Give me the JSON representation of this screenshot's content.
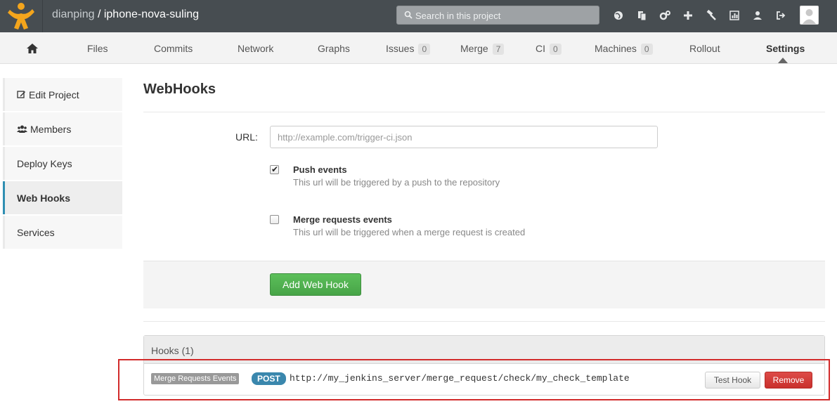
{
  "header": {
    "namespace": "dianping",
    "separator": " / ",
    "project": "iphone-nova-suling",
    "search_placeholder": "Search in this project",
    "icons": [
      "globe-icon",
      "copy-icon",
      "cogs-icon",
      "plus-icon",
      "hammer-icon",
      "chart-icon",
      "user-icon",
      "sign-out-icon"
    ],
    "logo_color": "#f4a51c"
  },
  "nav": {
    "items": [
      {
        "label": "Files"
      },
      {
        "label": "Commits"
      },
      {
        "label": "Network"
      },
      {
        "label": "Graphs"
      },
      {
        "label": "Issues",
        "count": "0"
      },
      {
        "label": "Merge",
        "count": "7"
      },
      {
        "label": "CI",
        "count": "0"
      },
      {
        "label": "Machines",
        "count": "0"
      },
      {
        "label": "Rollout"
      },
      {
        "label": "Settings"
      }
    ],
    "active": "Settings"
  },
  "sidebar": {
    "items": [
      {
        "label": "Edit Project",
        "icon": "edit-icon"
      },
      {
        "label": "Members",
        "icon": "users-icon"
      },
      {
        "label": "Deploy Keys"
      },
      {
        "label": "Web Hooks"
      },
      {
        "label": "Services"
      }
    ],
    "active": "Web Hooks"
  },
  "page": {
    "title": "WebHooks",
    "url_label": "URL:",
    "url_placeholder": "http://example.com/trigger-ci.json",
    "push_events": {
      "title": "Push events",
      "help": "This url will be triggered by a push to the repository",
      "checked": true
    },
    "merge_events": {
      "title": "Merge requests events",
      "help": "This url will be triggered when a merge request is created",
      "checked": false
    },
    "add_button": "Add Web Hook",
    "accent_green": "#47a447"
  },
  "hooks": {
    "title": "Hooks (1)",
    "rows": [
      {
        "event_label": "Merge Requests Events",
        "method": "POST",
        "url": "http://my_jenkins_server/merge_request/check/my_check_template",
        "test_label": "Test Hook",
        "remove_label": "Remove"
      }
    ],
    "highlight_color": "#d22b2b"
  }
}
